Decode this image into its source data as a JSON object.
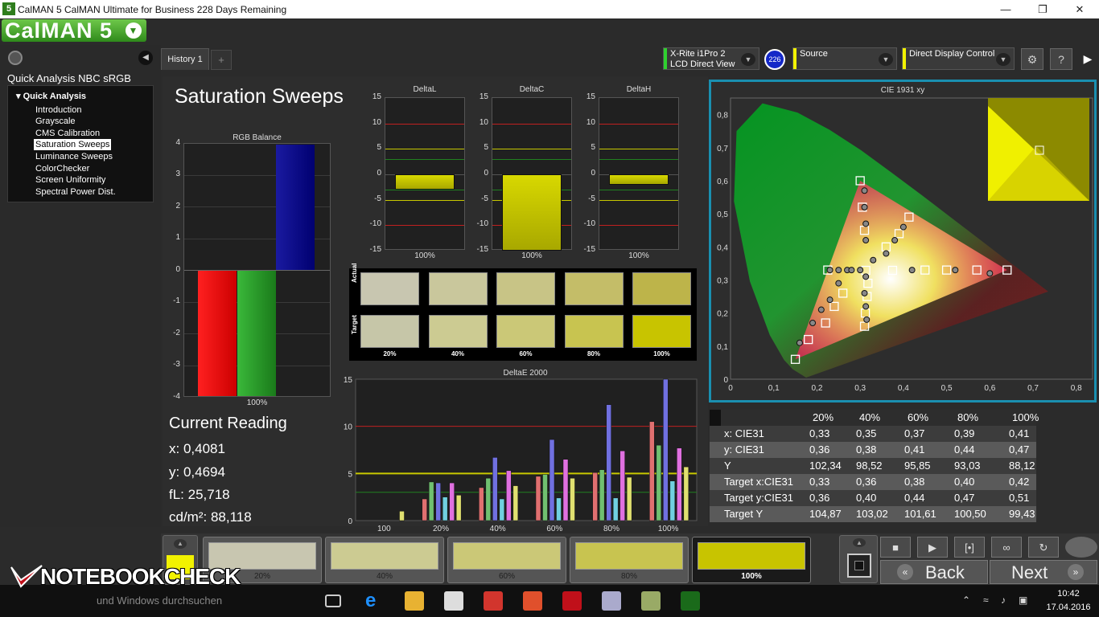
{
  "window": {
    "title": "CalMAN 5 CalMAN Ultimate for Business 228 Days Remaining",
    "app_icon": "5",
    "logo": "CalMAN 5"
  },
  "workflow": {
    "title": "Quick Analysis NBC sRGB",
    "root": "Quick Analysis",
    "items": [
      "Introduction",
      "Grayscale",
      "CMS Calibration",
      "Saturation Sweeps",
      "Luminance Sweeps",
      "ColorChecker",
      "Screen Uniformity",
      "Spectral Power Dist."
    ],
    "selected": "Saturation Sweeps"
  },
  "tabs": {
    "active": "History 1",
    "add": "+"
  },
  "devices": {
    "meter": {
      "line1": "X-Rite i1Pro 2",
      "line2": "LCD Direct View",
      "badge": "226",
      "color": "#2fd12f"
    },
    "source": {
      "label": "Source",
      "color": "#f2f200"
    },
    "display": {
      "label": "Direct Display Control",
      "color": "#f2f200"
    }
  },
  "page": {
    "title": "Saturation Sweeps"
  },
  "rgb_balance": {
    "title": "RGB Balance",
    "ticks": [
      "4",
      "3",
      "2",
      "1",
      "0",
      "-1",
      "-2",
      "-3",
      "-4"
    ],
    "xlabel": "100%",
    "values": {
      "red": -4,
      "green": -4,
      "blue": 4
    }
  },
  "delta_charts": [
    {
      "title": "DeltaL",
      "value": -3,
      "xlabel": "100%"
    },
    {
      "title": "DeltaC",
      "value": -15,
      "xlabel": "100%"
    },
    {
      "title": "DeltaH",
      "value": -2,
      "xlabel": "100%"
    }
  ],
  "delta_ticks": [
    "15",
    "10",
    "5",
    "0",
    "-5",
    "-10",
    "-15"
  ],
  "swatches": {
    "actual_label": "Actual",
    "target_label": "Target",
    "items": [
      {
        "label": "20%",
        "actual": "#c8c6b0",
        "target": "#c6c6a8"
      },
      {
        "label": "40%",
        "actual": "#c9c79c",
        "target": "#cccb92"
      },
      {
        "label": "60%",
        "actual": "#c8c486",
        "target": "#cbc877"
      },
      {
        "label": "80%",
        "actual": "#c4bd68",
        "target": "#c8c450"
      },
      {
        "label": "100%",
        "actual": "#bdb44a",
        "target": "#c8c400"
      }
    ]
  },
  "current_reading": {
    "title": "Current Reading",
    "x": "x: 0,4081",
    "y": "y: 0,4694",
    "fl": "fL: 25,718",
    "cdm2": "cd/m²: 88,118"
  },
  "cie": {
    "title": "CIE 1931 xy",
    "xticks": [
      "0",
      "0,1",
      "0,2",
      "0,3",
      "0,4",
      "0,5",
      "0,6",
      "0,7",
      "0,8"
    ],
    "yticks": [
      "0,8",
      "0,7",
      "0,6",
      "0,5",
      "0,4",
      "0,3",
      "0,2",
      "0,1",
      "0"
    ]
  },
  "table": {
    "headers": [
      "20%",
      "40%",
      "60%",
      "80%",
      "100%"
    ],
    "rows": [
      {
        "label": "x: CIE31",
        "values": [
          "0,33",
          "0,35",
          "0,37",
          "0,39",
          "0,41"
        ]
      },
      {
        "label": "y: CIE31",
        "values": [
          "0,36",
          "0,38",
          "0,41",
          "0,44",
          "0,47"
        ]
      },
      {
        "label": "Y",
        "values": [
          "102,34",
          "98,52",
          "95,85",
          "93,03",
          "88,12"
        ]
      },
      {
        "label": "Target x:CIE31",
        "values": [
          "0,33",
          "0,36",
          "0,38",
          "0,40",
          "0,42"
        ]
      },
      {
        "label": "Target y:CIE31",
        "values": [
          "0,36",
          "0,40",
          "0,44",
          "0,47",
          "0,51"
        ]
      },
      {
        "label": "Target Y",
        "values": [
          "104,87",
          "103,02",
          "101,61",
          "100,50",
          "99,43"
        ]
      }
    ]
  },
  "chart_data": {
    "type": "bar",
    "title": "DeltaE 2000",
    "categories": [
      "100",
      "20%",
      "40%",
      "60%",
      "80%",
      "100%"
    ],
    "ylim": [
      0,
      15
    ],
    "yticks": [
      "15",
      "10",
      "5",
      "0"
    ],
    "series": [
      {
        "color": "#e07070",
        "values": [
          0,
          2.3,
          3.5,
          4.7,
          5.1,
          10.5
        ]
      },
      {
        "color": "#70c070",
        "values": [
          0,
          4.1,
          4.5,
          4.9,
          5.4,
          8.0
        ]
      },
      {
        "color": "#7070e0",
        "values": [
          0,
          4.0,
          6.7,
          8.6,
          12.3,
          15.0
        ]
      },
      {
        "color": "#70d0e0",
        "values": [
          0,
          2.5,
          2.3,
          2.4,
          2.4,
          4.2
        ]
      },
      {
        "color": "#e070e0",
        "values": [
          0,
          4.0,
          5.3,
          6.5,
          7.4,
          7.7
        ]
      },
      {
        "color": "#e0e070",
        "values": [
          1.0,
          2.7,
          3.7,
          4.5,
          4.6,
          5.7
        ]
      }
    ]
  },
  "bottom_swatches": [
    {
      "label": "20%",
      "color": "#c8c6b0"
    },
    {
      "label": "40%",
      "color": "#cccb92"
    },
    {
      "label": "60%",
      "color": "#cbc877"
    },
    {
      "label": "80%",
      "color": "#c8c450"
    },
    {
      "label": "100%",
      "color": "#c8c400"
    }
  ],
  "controls": {
    "back": "Back",
    "next": "Next"
  },
  "watermark": "NOTEBOOKCHECK",
  "taskbar": {
    "search": "und Windows durchsuchen",
    "time": "10:42",
    "date": "17.04.2016"
  }
}
